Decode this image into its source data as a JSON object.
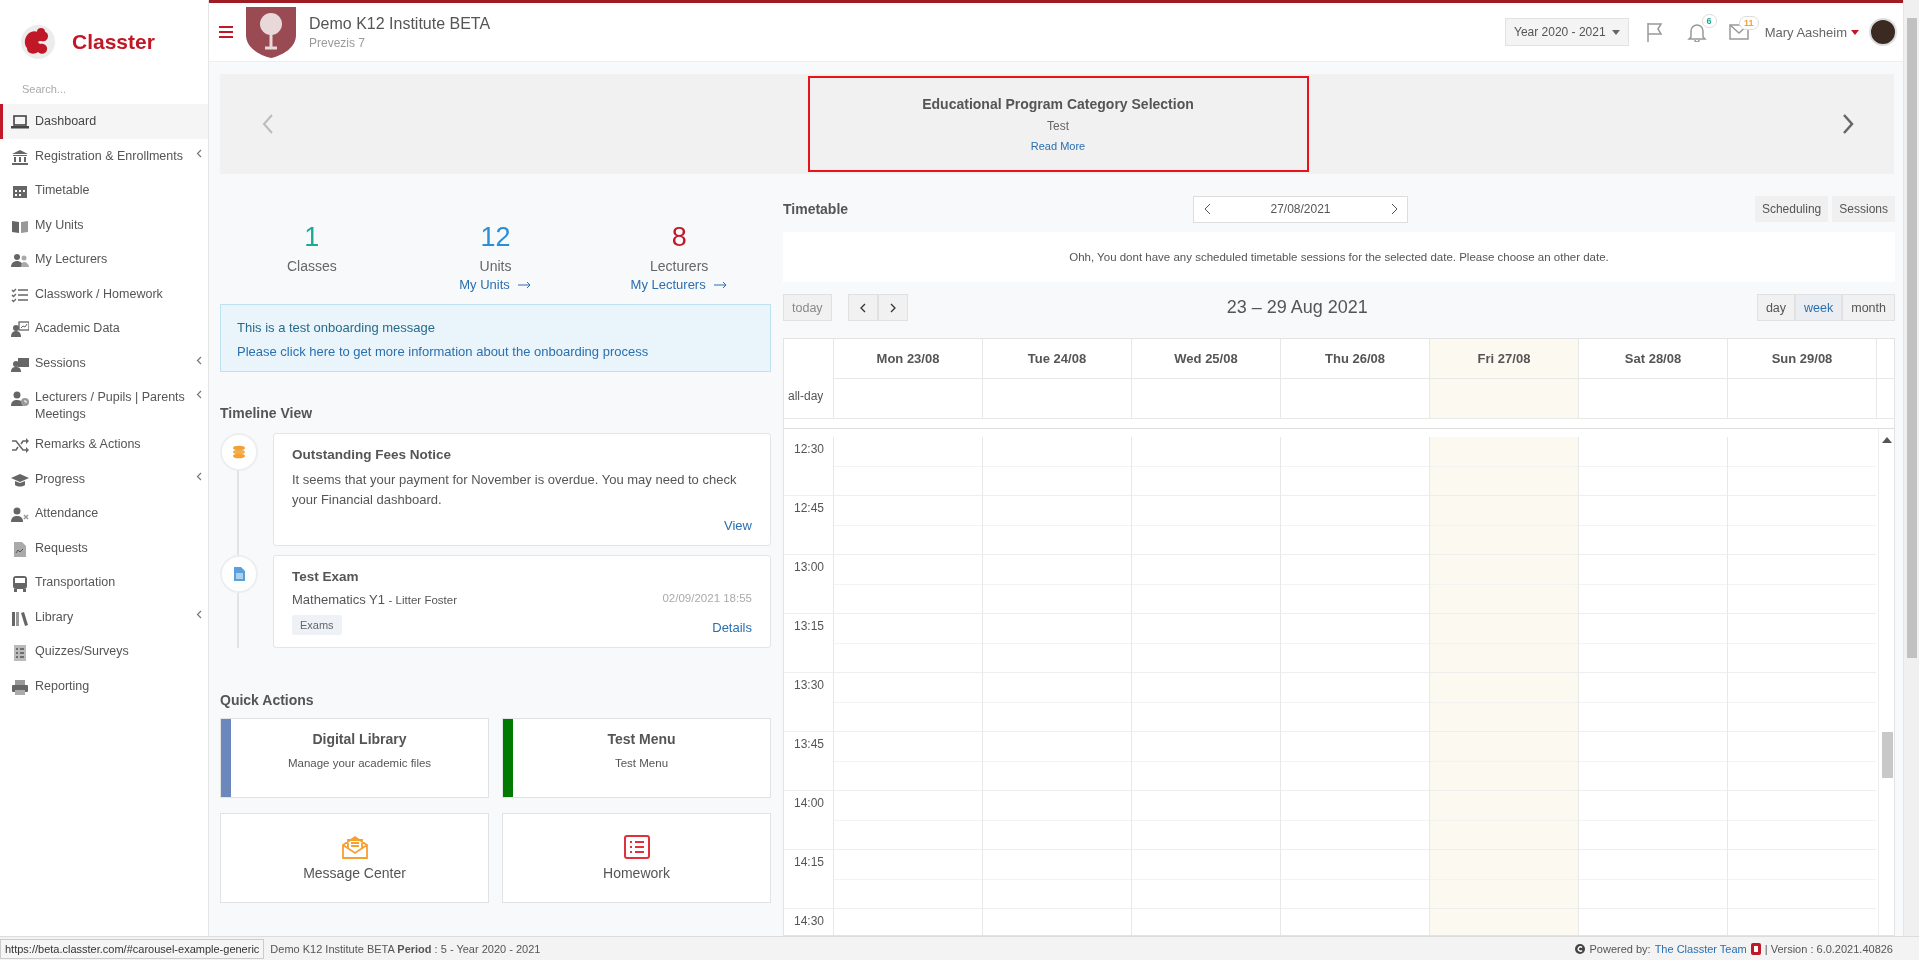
{
  "sidebar": {
    "brand": "Classter",
    "search_placeholder": "Search...",
    "items": [
      {
        "label": "Dashboard",
        "selected": true,
        "expandable": false
      },
      {
        "label": "Registration & Enrollments",
        "selected": false,
        "expandable": true
      },
      {
        "label": "Timetable",
        "selected": false,
        "expandable": false
      },
      {
        "label": "My Units",
        "selected": false,
        "expandable": false
      },
      {
        "label": "My Lecturers",
        "selected": false,
        "expandable": false
      },
      {
        "label": "Classwork / Homework",
        "selected": false,
        "expandable": false
      },
      {
        "label": "Academic Data",
        "selected": false,
        "expandable": false
      },
      {
        "label": "Sessions",
        "selected": false,
        "expandable": true
      },
      {
        "label": "Lecturers / Pupils | Parents Meetings",
        "selected": false,
        "expandable": true
      },
      {
        "label": "Remarks & Actions",
        "selected": false,
        "expandable": false
      },
      {
        "label": "Progress",
        "selected": false,
        "expandable": true
      },
      {
        "label": "Attendance",
        "selected": false,
        "expandable": false
      },
      {
        "label": "Requests",
        "selected": false,
        "expandable": false
      },
      {
        "label": "Transportation",
        "selected": false,
        "expandable": false
      },
      {
        "label": "Library",
        "selected": false,
        "expandable": true
      },
      {
        "label": "Quizzes/Surveys",
        "selected": false,
        "expandable": false
      },
      {
        "label": "Reporting",
        "selected": false,
        "expandable": false
      }
    ]
  },
  "header": {
    "institute": "Demo K12 Institute BETA",
    "subtitle": "Prevezis 7",
    "year": "Year 2020 - 2021",
    "notifications": "6",
    "messages": "11",
    "user": "Mary Aasheim"
  },
  "carousel": {
    "title": "Educational Program Category Selection",
    "text": "Test",
    "link": "Read More"
  },
  "stats": [
    {
      "value": "1",
      "label": "Classes",
      "color": "#1aaa95"
    },
    {
      "value": "12",
      "label": "Units",
      "link": "My Units",
      "color": "#2a8fd6"
    },
    {
      "value": "8",
      "label": "Lecturers",
      "link": "My Lecturers",
      "color": "#c01826"
    }
  ],
  "onboarding": {
    "message": "This is a test onboarding message",
    "link": "Please click here to get more information about the onboarding process"
  },
  "timeline": {
    "title": "Timeline View",
    "items": [
      {
        "kind": "notice",
        "title": "Outstanding Fees Notice",
        "text": "It seems that your payment for November is overdue. You may need to check your Financial dashboard.",
        "action": "View"
      },
      {
        "kind": "exam",
        "title": "Test Exam",
        "subject": "Mathematics Y1",
        "teacher": "- Litter Foster",
        "date": "02/09/2021 18:55",
        "tag": "Exams",
        "action": "Details"
      }
    ]
  },
  "quick_actions": {
    "title": "Quick Actions",
    "items": [
      {
        "kind": "bar",
        "title": "Digital Library",
        "subtitle": "Manage your academic files",
        "color": "#6a88bb"
      },
      {
        "kind": "bar",
        "title": "Test Menu",
        "subtitle": "Test Menu",
        "color": "#007a00"
      },
      {
        "kind": "icon",
        "title": "Message Center",
        "color": "#f5a030"
      },
      {
        "kind": "icon",
        "title": "Homework",
        "color": "#e0303c"
      }
    ]
  },
  "timetable": {
    "title": "Timetable",
    "date": "27/08/2021",
    "buttons": [
      "Scheduling",
      "Sessions"
    ],
    "message": "Ohh, You dont have any scheduled timetable sessions for the selected date. Please choose an other date.",
    "calendar": {
      "today": "today",
      "range": "23 – 29 Aug 2021",
      "views": [
        {
          "label": "day",
          "selected": false
        },
        {
          "label": "week",
          "selected": true
        },
        {
          "label": "month",
          "selected": false
        }
      ],
      "days": [
        {
          "label": "Mon 23/08",
          "today": false
        },
        {
          "label": "Tue 24/08",
          "today": false
        },
        {
          "label": "Wed 25/08",
          "today": false
        },
        {
          "label": "Thu 26/08",
          "today": false
        },
        {
          "label": "Fri 27/08",
          "today": true
        },
        {
          "label": "Sat 28/08",
          "today": false
        },
        {
          "label": "Sun 29/08",
          "today": false
        }
      ],
      "all_day": "all-day",
      "times": [
        "12:30",
        "12:45",
        "13:00",
        "13:15",
        "13:30",
        "13:45",
        "14:00",
        "14:15",
        "14:30"
      ]
    }
  },
  "footer": {
    "status_url": "https://beta.classter.com/#carousel-example-generic",
    "period": "Demo K12 Institute BETA **Period** : 5 - Year 2020 - 2021",
    "powered": "Powered by:",
    "team": "The Classter Team",
    "version": "| Version : 6.0.2021.40826"
  }
}
